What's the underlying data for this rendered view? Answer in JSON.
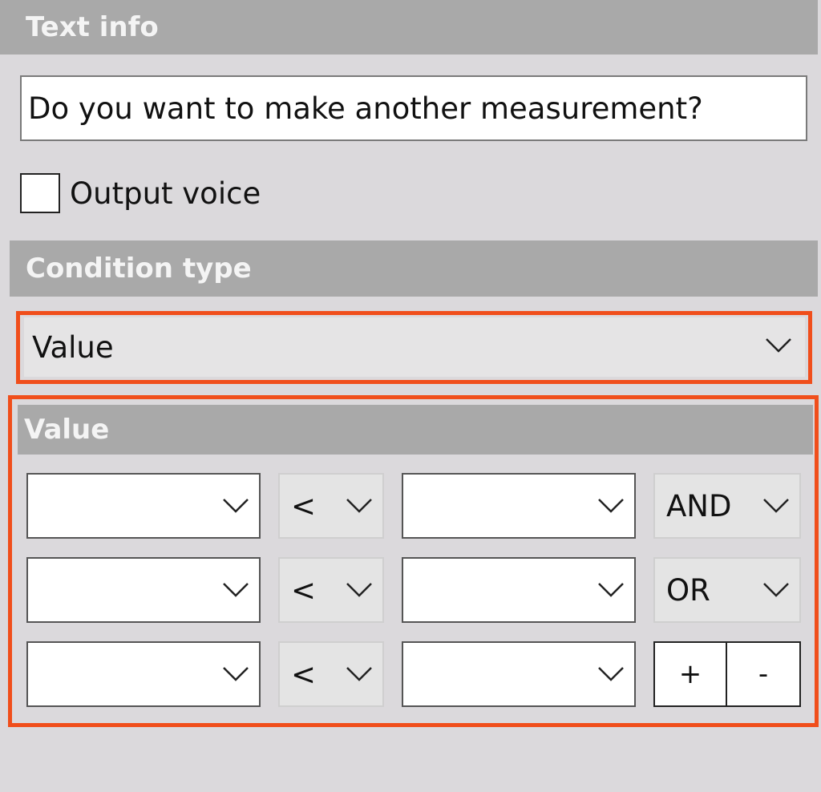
{
  "sections": {
    "text_info": "Text info",
    "condition_type": "Condition type",
    "value": "Value"
  },
  "text_info": {
    "field_value": "Do you want to make another measurement?",
    "output_voice_label": "Output voice",
    "output_voice_checked": false
  },
  "condition_type": {
    "selected": "Value"
  },
  "value_rows": [
    {
      "left": "",
      "operator": "<",
      "right": "",
      "logic": "AND"
    },
    {
      "left": "",
      "operator": "<",
      "right": "",
      "logic": "OR"
    },
    {
      "left": "",
      "operator": "<",
      "right": ""
    }
  ],
  "buttons": {
    "add": "+",
    "remove": "-"
  },
  "colors": {
    "background": "#dbd9dc",
    "section_header": "#a9a9a9",
    "highlight": "#f04e1b"
  },
  "icons": {
    "dropdown": "chevron-down-icon"
  }
}
